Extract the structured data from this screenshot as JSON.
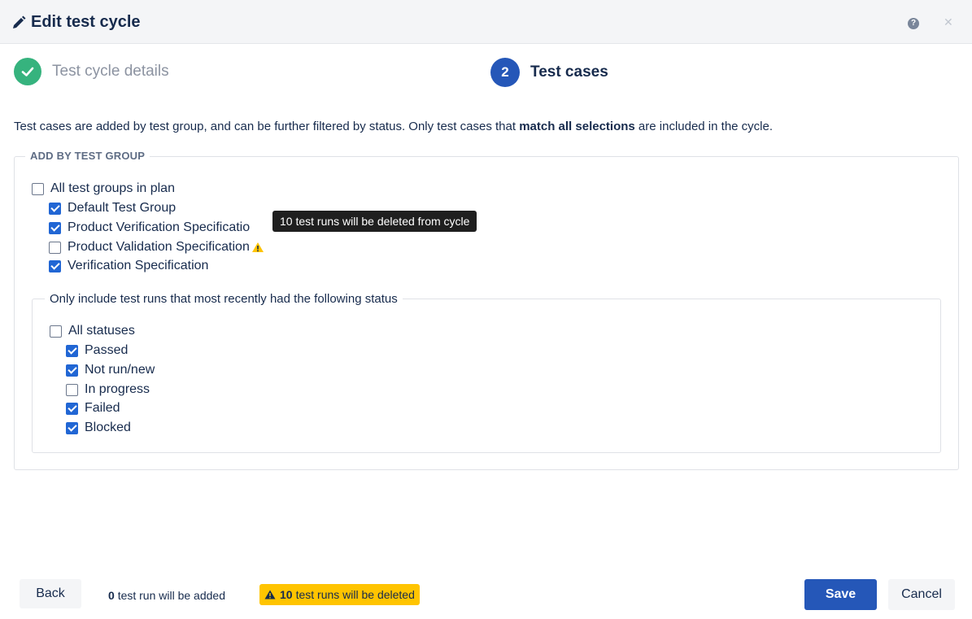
{
  "dialog": {
    "title": "Edit test cycle",
    "help_icon": "question-icon",
    "close_icon": "close-icon"
  },
  "steps": [
    {
      "label": "Test cycle details",
      "state": "completed",
      "icon": "check-icon"
    },
    {
      "number": "2",
      "label": "Test cases",
      "state": "active"
    }
  ],
  "intro": {
    "before": "Test cases are added by test group, and can be further filtered by status. Only test cases that ",
    "bold": "match all selections",
    "after": " are included in the cycle."
  },
  "test_groups": {
    "legend": "ADD BY TEST GROUP",
    "all_label": "All test groups in plan",
    "all_checked": false,
    "items": [
      {
        "label": "Default Test Group",
        "checked": true
      },
      {
        "label": "Product Verification Specificatio",
        "checked": true
      },
      {
        "label": "Product Validation Specification",
        "checked": false,
        "warning_icon": "warning-icon"
      },
      {
        "label": "Verification Specification",
        "checked": true
      }
    ],
    "tooltip": "10 test runs will be deleted from cycle"
  },
  "status_filter": {
    "legend": "Only include test runs that most recently had the following status",
    "all_label": "All statuses",
    "all_checked": false,
    "items": [
      {
        "label": "Passed",
        "checked": true
      },
      {
        "label": "Not run/new",
        "checked": true
      },
      {
        "label": "In progress",
        "checked": false
      },
      {
        "label": "Failed",
        "checked": true
      },
      {
        "label": "Blocked",
        "checked": true
      }
    ]
  },
  "footer": {
    "back_label": "Back",
    "added_count": "0",
    "added_text": "test run will be added",
    "deleted_count": "10",
    "deleted_text": "test runs will be deleted",
    "save_label": "Save",
    "cancel_label": "Cancel"
  },
  "colors": {
    "primary": "#2557b8",
    "success": "#36b37e",
    "warning": "#ffc400",
    "checkbox": "#2166d4"
  }
}
